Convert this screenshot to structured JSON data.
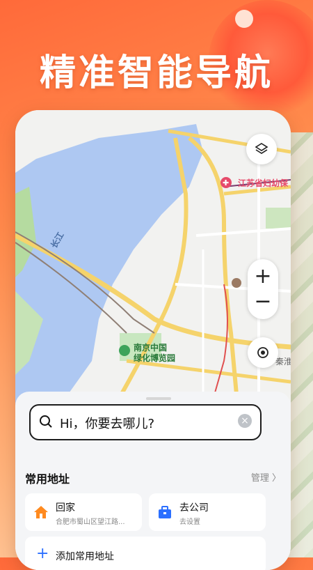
{
  "headline": "精准智能导航",
  "map": {
    "labels": {
      "river": "长江",
      "hospital": "江苏省妇幼保",
      "museum": "南京",
      "park_line1": "南京中国",
      "park_line2": "绿化博览园",
      "street": "秦淮"
    }
  },
  "controls": {
    "zoom_in": "+",
    "zoom_out": "−"
  },
  "search": {
    "placeholder": "Hi，你要去哪儿?"
  },
  "common": {
    "title": "常用地址",
    "manage": "管理 〉",
    "home": {
      "title": "回家",
      "subtitle": "合肥市蜀山区望江路..."
    },
    "company": {
      "title": "去公司",
      "subtitle": "去设置"
    },
    "add": "添加常用地址"
  },
  "colors": {
    "accent": "#ff6a3a",
    "home_icon": "#ff8a1f",
    "company_icon": "#2b6fff",
    "hospital": "#e64a6a"
  }
}
